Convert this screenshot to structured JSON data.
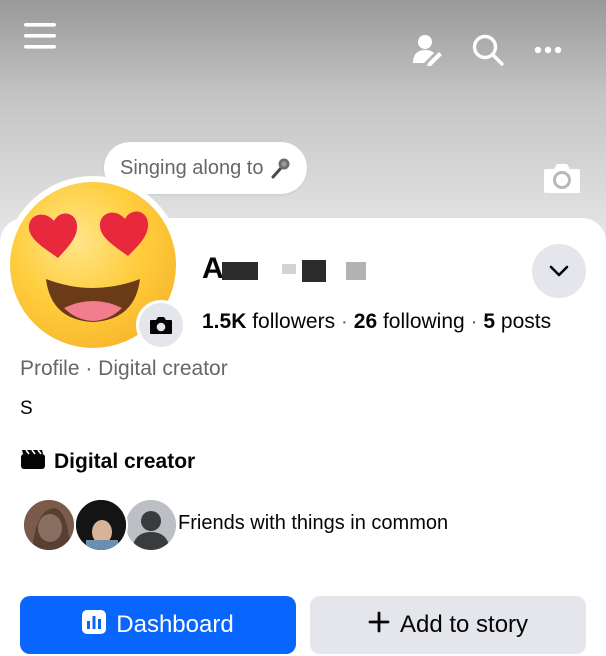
{
  "header": {
    "icons": [
      "menu-icon",
      "profile-icon",
      "search-icon",
      "more-icon"
    ]
  },
  "note": {
    "text": "Singing along to",
    "icon": "microphone-icon"
  },
  "profile": {
    "name_visible": "A",
    "avatar": "heart-eyes-emoji",
    "stats": {
      "followers_count": "1.5K",
      "followers_label": "followers",
      "following_count": "26",
      "following_label": "following",
      "posts_count": "5",
      "posts_label": "posts",
      "separator": "·"
    },
    "category_line": "Profile · Digital creator",
    "bio_initial": "S",
    "creator_label": "Digital creator"
  },
  "friends": {
    "label": "Friends with things in common"
  },
  "actions": {
    "dashboard_label": "Dashboard",
    "add_story_label": "Add to story"
  },
  "colors": {
    "primary_button": "#0866ff",
    "secondary_button": "#e4e6eb",
    "text_primary": "#050505",
    "text_secondary": "#65676b"
  }
}
